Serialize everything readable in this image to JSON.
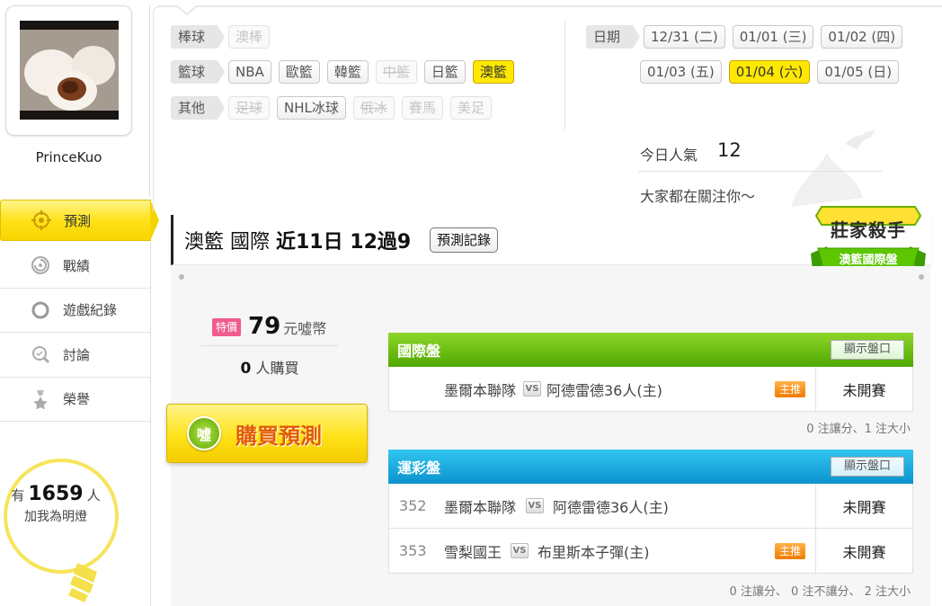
{
  "profile": {
    "username": "PrinceKuo"
  },
  "sidebar": {
    "items": [
      {
        "label": "預測"
      },
      {
        "label": "戰績"
      },
      {
        "label": "遊戲紀錄"
      },
      {
        "label": "討論"
      },
      {
        "label": "榮譽"
      }
    ]
  },
  "fans": {
    "prefix": "有",
    "count": "1659",
    "suffix": "人",
    "subtitle": "加我為明燈"
  },
  "filters": {
    "baseball": {
      "label": "棒球",
      "items": [
        "澳棒"
      ]
    },
    "basketball": {
      "label": "籃球",
      "items": [
        "NBA",
        "歐籃",
        "韓籃",
        "中籃",
        "日籃",
        "澳籃"
      ]
    },
    "other": {
      "label": "其他",
      "items": [
        "足球",
        "NHL冰球",
        "俄冰",
        "賽馬",
        "美足"
      ]
    },
    "date": {
      "label": "日期",
      "items": [
        "12/31 (二)",
        "01/01 (三)",
        "01/02 (四)",
        "01/03 (五)",
        "01/04 (六)",
        "01/05 (日)"
      ]
    }
  },
  "stats": {
    "popularity_label": "今日人氣",
    "popularity_value": "12",
    "follow_text": "大家都在關注你～"
  },
  "header": {
    "league": "澳籃 國際",
    "streak": "近11日 12過9",
    "record_button": "預測記錄"
  },
  "badge": {
    "line1": "莊家殺手",
    "line2": "澳籃國際盤"
  },
  "purchase": {
    "tag": "特價",
    "price": "79",
    "unit": "元噓幣",
    "buyers_count": "0",
    "buyers_suffix": "人購買",
    "buy_button": "購買預測",
    "coin": "噓"
  },
  "intl": {
    "title": "國際盤",
    "show_button": "顯示盤口",
    "rows": [
      {
        "no": "",
        "home": "墨爾本聯隊",
        "vs": "VS",
        "away": "阿德雷德36人(主)",
        "push": "主推",
        "status": "未開賽"
      }
    ],
    "footer": "0 注讓分、1 注大小"
  },
  "sports_lottery": {
    "title": "運彩盤",
    "show_button": "顯示盤口",
    "rows": [
      {
        "no": "352",
        "home": "墨爾本聯隊",
        "vs": "VS",
        "away": "阿德雷德36人(主)",
        "push": "",
        "status": "未開賽"
      },
      {
        "no": "353",
        "home": "雪梨國王",
        "vs": "VS",
        "away": "布里斯本子彈(主)",
        "push": "主推",
        "status": "未開賽"
      }
    ],
    "footer": "0 注讓分、 0 注不讓分、 2 注大小"
  }
}
